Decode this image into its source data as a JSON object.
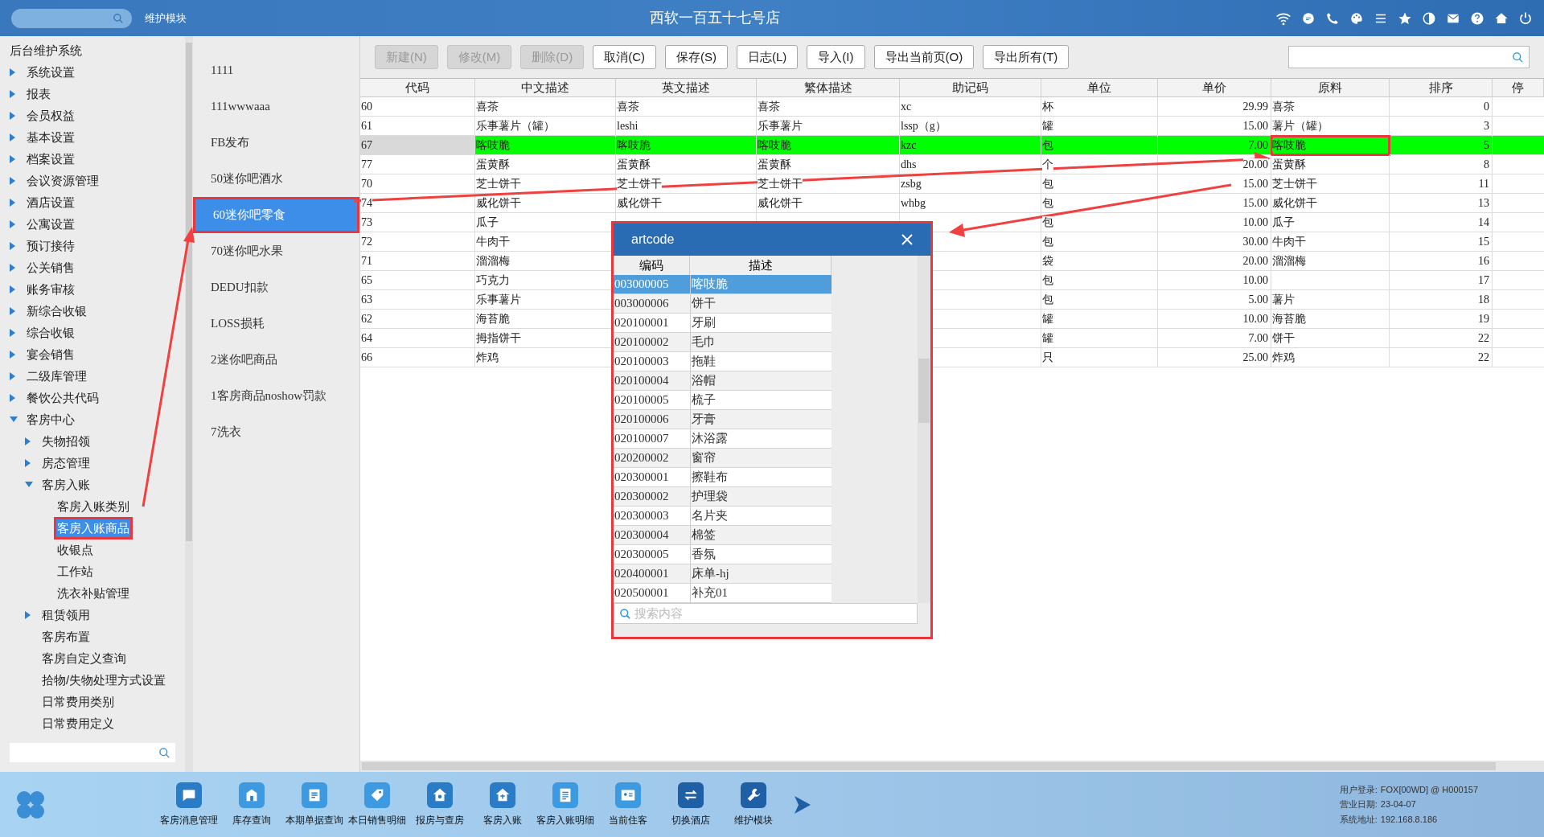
{
  "top_bar": {
    "module": "维护模块",
    "title": "西软一百五十七号店"
  },
  "sidebar": {
    "title": "后台维护系统",
    "items": [
      {
        "label": "系统设置",
        "expanded": false,
        "selected": false,
        "marked": false
      },
      {
        "label": "报表",
        "expanded": false,
        "selected": false,
        "marked": false
      },
      {
        "label": "会员权益",
        "expanded": false,
        "selected": false,
        "marked": false
      },
      {
        "label": "基本设置",
        "expanded": false,
        "selected": false,
        "marked": false
      },
      {
        "label": "档案设置",
        "expanded": false,
        "selected": false,
        "marked": false
      },
      {
        "label": "会议资源管理",
        "expanded": false,
        "selected": false,
        "marked": false
      },
      {
        "label": "酒店设置",
        "expanded": false,
        "selected": false,
        "marked": false
      },
      {
        "label": "公寓设置",
        "expanded": false,
        "selected": false,
        "marked": false
      },
      {
        "label": "预订接待",
        "expanded": false,
        "selected": false,
        "marked": false
      },
      {
        "label": "公关销售",
        "expanded": false,
        "selected": false,
        "marked": false
      },
      {
        "label": "账务审核",
        "expanded": false,
        "selected": false,
        "marked": false
      },
      {
        "label": "新综合收银",
        "expanded": false,
        "selected": false,
        "marked": false
      },
      {
        "label": "综合收银",
        "expanded": false,
        "selected": false,
        "marked": false
      },
      {
        "label": "宴会销售",
        "expanded": false,
        "selected": false,
        "marked": false
      },
      {
        "label": "二级库管理",
        "expanded": false,
        "selected": false,
        "marked": false
      },
      {
        "label": "餐饮公共代码",
        "expanded": false,
        "selected": false,
        "marked": false
      },
      {
        "label": "客房中心",
        "expanded": true,
        "selected": false,
        "marked": false,
        "children": [
          {
            "label": "失物招领",
            "expanded": false,
            "selected": false,
            "marked": false
          },
          {
            "label": "房态管理",
            "expanded": false,
            "selected": false,
            "marked": false
          },
          {
            "label": "客房入账",
            "expanded": true,
            "selected": false,
            "marked": false,
            "children": [
              {
                "label": "客房入账类别",
                "selected": false,
                "marked": false
              },
              {
                "label": "客房入账商品",
                "selected": true,
                "marked": true
              },
              {
                "label": "收银点",
                "selected": false,
                "marked": false
              },
              {
                "label": "工作站",
                "selected": false,
                "marked": false
              },
              {
                "label": "洗衣补贴管理",
                "selected": false,
                "marked": false
              }
            ]
          },
          {
            "label": "租赁领用",
            "expanded": false,
            "selected": false,
            "marked": false
          },
          {
            "label": "客房布置",
            "selected": false,
            "marked": false
          },
          {
            "label": "客房自定义查询",
            "selected": false,
            "marked": false
          },
          {
            "label": "拾物/失物处理方式设置",
            "selected": false,
            "marked": false
          },
          {
            "label": "日常费用类别",
            "selected": false,
            "marked": false
          },
          {
            "label": "日常费用定义",
            "selected": false,
            "marked": false
          }
        ]
      }
    ]
  },
  "categories": [
    {
      "label": "1111",
      "selected": false,
      "marked": false
    },
    {
      "label": "111wwwaaa",
      "selected": false,
      "marked": false
    },
    {
      "label": "FB发布",
      "selected": false,
      "marked": false
    },
    {
      "label": "50迷你吧酒水",
      "selected": false,
      "marked": false
    },
    {
      "label": "60迷你吧零食",
      "selected": true,
      "marked": true
    },
    {
      "label": "70迷你吧水果",
      "selected": false,
      "marked": false
    },
    {
      "label": "DEDU扣款",
      "selected": false,
      "marked": false
    },
    {
      "label": "LOSS损耗",
      "selected": false,
      "marked": false
    },
    {
      "label": "2迷你吧商品",
      "selected": false,
      "marked": false
    },
    {
      "label": "1客房商品noshow罚款",
      "selected": false,
      "marked": false
    },
    {
      "label": "7洗衣",
      "selected": false,
      "marked": false
    }
  ],
  "toolbar": {
    "buttons": [
      {
        "label": "新建(N)",
        "disabled": true
      },
      {
        "label": "修改(M)",
        "disabled": true
      },
      {
        "label": "删除(D)",
        "disabled": true
      },
      {
        "label": "取消(C)",
        "disabled": false
      },
      {
        "label": "保存(S)",
        "disabled": false
      },
      {
        "label": "日志(L)",
        "disabled": false
      },
      {
        "label": "导入(I)",
        "disabled": false
      },
      {
        "label": "导出当前页(O)",
        "disabled": false
      },
      {
        "label": "导出所有(T)",
        "disabled": false
      }
    ]
  },
  "table": {
    "columns": [
      "代码",
      "中文描述",
      "英文描述",
      "繁体描述",
      "助记码",
      "单位",
      "单价",
      "原料",
      "排序",
      "停"
    ],
    "rows": [
      {
        "selected": false,
        "material_marked": false,
        "cells": [
          "60",
          "喜茶",
          "喜茶",
          "喜茶",
          "xc",
          "杯",
          "29.99",
          "喜茶",
          "0"
        ]
      },
      {
        "selected": false,
        "material_marked": false,
        "cells": [
          "61",
          "乐事薯片（罐）",
          "leshi",
          "乐事薯片",
          "lssp（g）",
          "罐",
          "15.00",
          "薯片（罐）",
          "3"
        ]
      },
      {
        "selected": true,
        "material_marked": true,
        "cells": [
          "67",
          "喀吱脆",
          "喀吱脆",
          "喀吱脆",
          "kzc",
          "包",
          "7.00",
          "喀吱脆",
          "5"
        ]
      },
      {
        "selected": false,
        "material_marked": false,
        "cells": [
          "77",
          "蛋黄酥",
          "蛋黄酥",
          "蛋黄酥",
          "dhs",
          "个",
          "20.00",
          "蛋黄酥",
          "8"
        ]
      },
      {
        "selected": false,
        "material_marked": false,
        "cells": [
          "70",
          "芝士饼干",
          "芝士饼干",
          "芝士饼干",
          "zsbg",
          "包",
          "15.00",
          "芝士饼干",
          "11"
        ]
      },
      {
        "selected": false,
        "material_marked": false,
        "cells": [
          "74",
          "威化饼干",
          "威化饼干",
          "威化饼干",
          "whbg",
          "包",
          "15.00",
          "威化饼干",
          "13"
        ]
      },
      {
        "selected": false,
        "material_marked": false,
        "cells": [
          "73",
          "瓜子",
          "",
          "",
          "",
          "包",
          "10.00",
          "瓜子",
          "14"
        ]
      },
      {
        "selected": false,
        "material_marked": false,
        "cells": [
          "72",
          "牛肉干",
          "",
          "",
          "",
          "包",
          "30.00",
          "牛肉干",
          "15"
        ]
      },
      {
        "selected": false,
        "material_marked": false,
        "cells": [
          "71",
          "溜溜梅",
          "",
          "",
          "",
          "袋",
          "20.00",
          "溜溜梅",
          "16"
        ]
      },
      {
        "selected": false,
        "material_marked": false,
        "cells": [
          "65",
          "巧克力",
          "",
          "",
          "",
          "包",
          "10.00",
          "",
          "17"
        ]
      },
      {
        "selected": false,
        "material_marked": false,
        "cells": [
          "63",
          "乐事薯片",
          "",
          "",
          "",
          "包",
          "5.00",
          "薯片",
          "18"
        ]
      },
      {
        "selected": false,
        "material_marked": false,
        "cells": [
          "62",
          "海苔脆",
          "",
          "",
          "",
          "罐",
          "10.00",
          "海苔脆",
          "19"
        ]
      },
      {
        "selected": false,
        "material_marked": false,
        "cells": [
          "64",
          "拇指饼干",
          "",
          "",
          "",
          "罐",
          "7.00",
          "饼干",
          "22"
        ]
      },
      {
        "selected": false,
        "material_marked": false,
        "cells": [
          "66",
          "炸鸡",
          "",
          "",
          "",
          "只",
          "25.00",
          "炸鸡",
          "22"
        ]
      }
    ]
  },
  "popup": {
    "title": "artcode",
    "columns": [
      "编码",
      "描述"
    ],
    "rows": [
      {
        "code": "003000005",
        "desc": "喀吱脆",
        "selected": true
      },
      {
        "code": "003000006",
        "desc": "饼干",
        "selected": false
      },
      {
        "code": "020100001",
        "desc": "牙刷",
        "selected": false
      },
      {
        "code": "020100002",
        "desc": "毛巾",
        "selected": false
      },
      {
        "code": "020100003",
        "desc": "拖鞋",
        "selected": false
      },
      {
        "code": "020100004",
        "desc": "浴帽",
        "selected": false
      },
      {
        "code": "020100005",
        "desc": "梳子",
        "selected": false
      },
      {
        "code": "020100006",
        "desc": "牙膏",
        "selected": false
      },
      {
        "code": "020100007",
        "desc": "沐浴露",
        "selected": false
      },
      {
        "code": "020200002",
        "desc": "窗帘",
        "selected": false
      },
      {
        "code": "020300001",
        "desc": "擦鞋布",
        "selected": false
      },
      {
        "code": "020300002",
        "desc": "护理袋",
        "selected": false
      },
      {
        "code": "020300003",
        "desc": "名片夹",
        "selected": false
      },
      {
        "code": "020300004",
        "desc": "棉签",
        "selected": false
      },
      {
        "code": "020300005",
        "desc": "香氛",
        "selected": false
      },
      {
        "code": "020400001",
        "desc": "床单-hj",
        "selected": false
      },
      {
        "code": "020500001",
        "desc": "补充01",
        "selected": false
      }
    ],
    "search": {
      "placeholder": "搜索内容"
    }
  },
  "dock": {
    "items": [
      "客房消息管理",
      "库存查询",
      "本期单据查询",
      "本日销售明细",
      "报房与查房",
      "客房入账",
      "客房入账明细",
      "当前住客",
      "切换酒店",
      "维护模块"
    ]
  },
  "status": [
    {
      "label": "用户登录:",
      "value": "FOX[00WD] @ H000157"
    },
    {
      "label": "营业日期:",
      "value": "23-04-07"
    },
    {
      "label": "系统地址:",
      "value": "192.168.8.186"
    }
  ]
}
